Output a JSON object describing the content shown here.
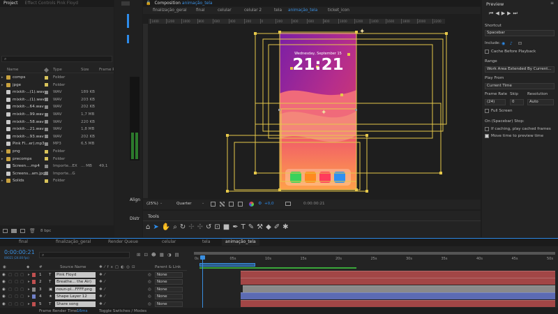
{
  "project_panel": {
    "tabs": [
      "Project",
      "Effect Controls Pink Floyd"
    ],
    "columns": {
      "name": "Name",
      "type": "Type",
      "size": "Size",
      "frame_rate": "Frame R..."
    },
    "items": [
      {
        "name": "comps",
        "type": "Folder",
        "size": "",
        "fr": "",
        "icon": "folder-icon",
        "label": "yl",
        "indent": 0
      },
      {
        "name": "jpge",
        "type": "Folder",
        "size": "",
        "fr": "",
        "icon": "folder-icon",
        "label": "yl",
        "indent": 0
      },
      {
        "name": "mixkit-...(1).wav",
        "type": "WAV",
        "size": "189 KB",
        "fr": "",
        "icon": "audio-file-icon",
        "label": "gr",
        "indent": 0
      },
      {
        "name": "mixkit-...(1).wav",
        "type": "WAV",
        "size": "203 KB",
        "fr": "",
        "icon": "audio-file-icon",
        "label": "gr",
        "indent": 0
      },
      {
        "name": "mixkit-...64.wav",
        "type": "WAV",
        "size": "202 KB",
        "fr": "",
        "icon": "audio-file-icon",
        "label": "gr",
        "indent": 0
      },
      {
        "name": "mixkit-...99.wav",
        "type": "WAV",
        "size": "1,7 MB",
        "fr": "",
        "icon": "audio-file-icon",
        "label": "gr",
        "indent": 0
      },
      {
        "name": "mixkit-...58.wav",
        "type": "WAV",
        "size": "220 KB",
        "fr": "",
        "icon": "audio-file-icon",
        "label": "gr",
        "indent": 0
      },
      {
        "name": "mixkit-...21.wav",
        "type": "WAV",
        "size": "1,8 MB",
        "fr": "",
        "icon": "audio-file-icon",
        "label": "gr",
        "indent": 0
      },
      {
        "name": "mixkit-...93.wav",
        "type": "WAV",
        "size": "202 KB",
        "fr": "",
        "icon": "audio-file-icon",
        "label": "gr",
        "indent": 0
      },
      {
        "name": "Pink Fl...er).mp3",
        "type": "MP3",
        "size": "6,5 MB",
        "fr": "",
        "icon": "audio-file-icon",
        "label": "gr",
        "indent": 0
      },
      {
        "name": "png",
        "type": "Folder",
        "size": "",
        "fr": "",
        "icon": "folder-icon",
        "label": "yl",
        "indent": 0
      },
      {
        "name": "precomps",
        "type": "Folder",
        "size": "",
        "fr": "",
        "icon": "folder-icon",
        "label": "yl",
        "indent": 0
      },
      {
        "name": "Screen....mp4",
        "type": "Importe...EX",
        "size": "... MB",
        "fr": "49,1",
        "icon": "video-file-icon",
        "label": "gr",
        "indent": 0
      },
      {
        "name": "Screens...am.jpg",
        "type": "Importe...G",
        "size": "",
        "fr": "",
        "icon": "image-file-icon",
        "label": "gr",
        "indent": 0
      },
      {
        "name": "Solids",
        "type": "Folder",
        "size": "",
        "fr": "",
        "icon": "folder-icon",
        "label": "yl",
        "indent": 0
      }
    ],
    "footer": {
      "bpc": "8 bpc"
    }
  },
  "side_panels": {
    "align": "Align",
    "distribute": "Distr"
  },
  "composition": {
    "panel_title": "Composition",
    "panel_title_name": "animação_tela",
    "breadcrumbs": [
      "finalização_geral",
      "final",
      "celular",
      "celular 2",
      "tela",
      "animação_tela",
      "ticket_icon"
    ],
    "active_breadcrumb": 5,
    "ruler_ticks": [
      "1400",
      "1200",
      "1000",
      "800",
      "600",
      "400",
      "200",
      "0",
      "200",
      "400",
      "600",
      "800",
      "1000",
      "1200",
      "1400",
      "1600",
      "1800",
      "2000",
      "2200"
    ],
    "phone": {
      "date": "Wednesday, September 15",
      "time": "21:21"
    },
    "footer": {
      "zoom": "(25%)",
      "resolution": "Quarter",
      "exposure": "+0,0",
      "timecode": "0:00:00:21"
    }
  },
  "tools": {
    "title": "Tools"
  },
  "preview": {
    "title": "Preview",
    "shortcut_label": "Shortcut",
    "shortcut_value": "Spacebar",
    "include_label": "Include:",
    "cache_before_playback": "Cache Before Playback",
    "range_label": "Range",
    "range_value": "Work Area Extended By Current...",
    "play_from_label": "Play From",
    "play_from_value": "Current Time",
    "frame_rate_label": "Frame Rate",
    "skip_label": "Skip",
    "resolution_label": "Resolution",
    "frame_rate_value": "(24)",
    "skip_value": "0",
    "resolution_value": "Auto",
    "full_screen": "Full Screen",
    "on_stop_label": "On (Spacebar) Stop:",
    "if_caching": "If caching, play cached frames",
    "move_time": "Move time to preview time"
  },
  "timeline": {
    "tabs": [
      "final",
      "finalização_geral",
      "Render Queue",
      "celular",
      "tela",
      "animação_tela"
    ],
    "active_tab": 5,
    "timecode": "0:00:00:21",
    "timecode_sub": "00021 (24.00 fps)",
    "search_placeholder": "",
    "columns": {
      "num": "#",
      "source": "Source Name",
      "parent": "Parent & Link"
    },
    "layers": [
      {
        "num": "1",
        "type": "T",
        "name": "Pink Floyd",
        "parent": "None",
        "label_color": "#c05050",
        "bar_color": "#a24646"
      },
      {
        "num": "2",
        "type": "T",
        "name": "Breathe... the Air)",
        "parent": "None",
        "label_color": "#c05050",
        "bar_color": "#a24646"
      },
      {
        "num": "3",
        "type": "img",
        "name": "noun-pl...FFFF.png",
        "parent": "None",
        "label_color": "#8a8a8a",
        "bar_color": "#8a8a8a"
      },
      {
        "num": "4",
        "type": "star",
        "name": "Shape Layer 12",
        "parent": "None",
        "label_color": "#7080c8",
        "bar_color": "#5c6bb3"
      },
      {
        "num": "5",
        "type": "T",
        "name": "Share song",
        "parent": "None",
        "label_color": "#c05050",
        "bar_color": "#a24646"
      }
    ],
    "ruler": [
      "0s",
      "05s",
      "10s",
      "15s",
      "20s",
      "25s",
      "30s",
      "35s",
      "40s",
      "45s",
      "50s"
    ],
    "footer": {
      "render_time_label": "Frame Render Time:",
      "render_time_value": "16ms",
      "toggle": "Toggle Switches / Modes"
    }
  },
  "colors": {
    "accent": "#2d8ceb",
    "selection_box": "#e6c84a",
    "timecode_blue": "#3a8fe0"
  }
}
